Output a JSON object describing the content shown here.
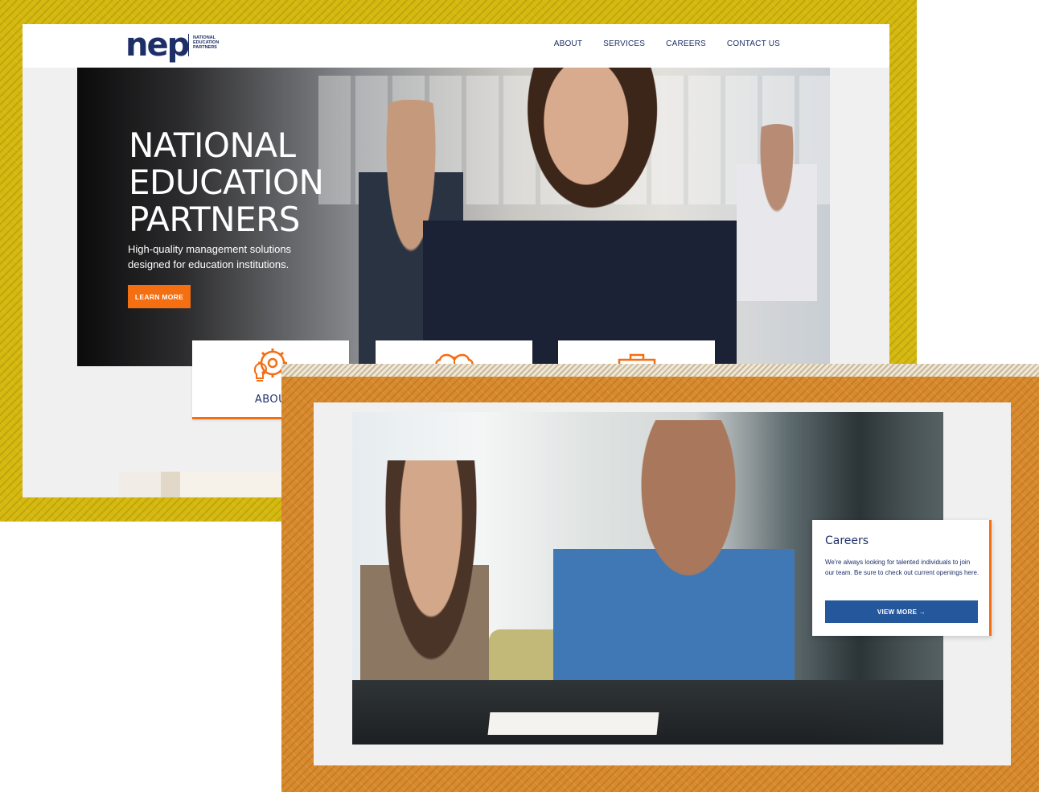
{
  "colors": {
    "navy": "#1e2f68",
    "orange": "#f46e12",
    "blue_button": "#24579b",
    "frame_yellow": "#d5b90f",
    "frame_orange": "#d98a2c",
    "page_gray": "#f0f0f0"
  },
  "header": {
    "logo": {
      "mark": "nep",
      "lines": [
        "NATIONAL",
        "EDUCATION",
        "PARTNERS"
      ]
    },
    "nav": [
      "ABOUT",
      "SERVICES",
      "CAREERS",
      "CONTACT US"
    ]
  },
  "hero": {
    "title_lines": [
      "NATIONAL",
      "EDUCATION",
      "PARTNERS"
    ],
    "subtitle_lines": [
      "High-quality management solutions",
      "designed for education institutions."
    ],
    "cta_label": "LEARN MORE"
  },
  "cards": [
    {
      "label": "ABOU",
      "icon": "gear-lightbulb-icon"
    },
    {
      "label": "",
      "icon": "brain-icon"
    },
    {
      "label": "",
      "icon": "briefcase-icon"
    }
  ],
  "careers": {
    "title": "Careers",
    "body": "We're always looking for talented individuals to join our team. Be sure to check out current openings here.",
    "button_label": "VIEW MORE →"
  }
}
